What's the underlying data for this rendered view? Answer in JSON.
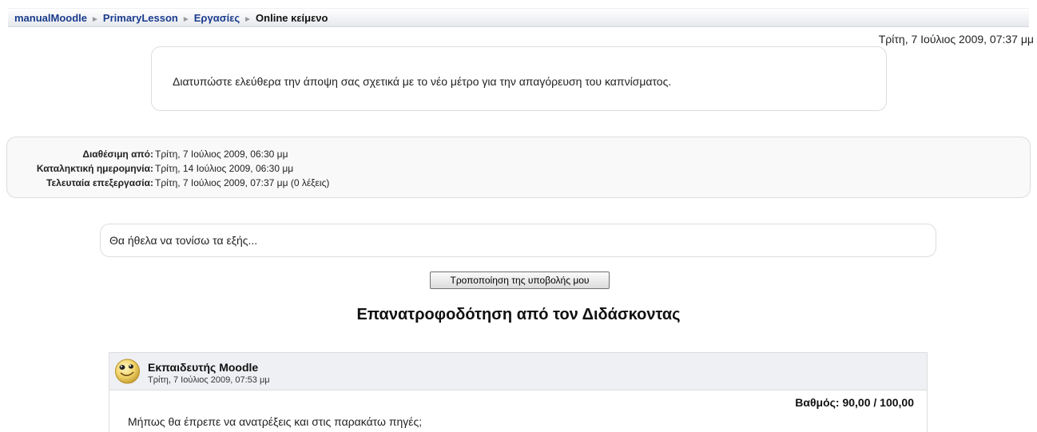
{
  "breadcrumb": {
    "items": [
      "manualMoodle",
      "PrimaryLesson",
      "Εργασίες"
    ],
    "current": "Online κείμενο"
  },
  "top_date": "Τρίτη, 7 Ιούλιος 2009, 07:37 μμ",
  "intro": {
    "text": "Διατυπώστε ελεύθερα την άποψη σας σχετικά με το νέο μέτρο για την απαγόρευση του καπνίσματος."
  },
  "info": [
    {
      "label": "Διαθέσιμη από:",
      "value": "Τρίτη, 7 Ιούλιος 2009, 06:30 μμ"
    },
    {
      "label": "Καταληκτική ημερομηνία:",
      "value": "Τρίτη, 14 Ιούλιος 2009, 06:30 μμ"
    },
    {
      "label": "Τελευταία επεξεργασία:",
      "value": "Τρίτη, 7 Ιούλιος 2009, 07:37 μμ (0 λέξεις)"
    }
  ],
  "submission": {
    "text": "Θα ήθελα να τονίσω τα εξής..."
  },
  "edit_button": "Τροποποίηση της υποβολής μου",
  "feedback": {
    "heading": "Επανατροφοδότηση από τον Διδάσκοντας",
    "teacher": "Εκπαιδευτής Moodle",
    "date": "Τρίτη, 7 Ιούλιος 2009, 07:53 μμ",
    "grade": "Βαθμός: 90,00 / 100,00",
    "text": "Μήπως θα έπρεπε να ανατρέξεις και στις παρακάτω πηγές;"
  }
}
